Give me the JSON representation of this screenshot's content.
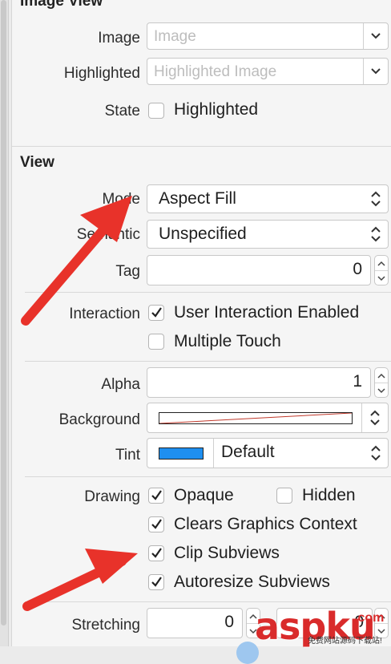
{
  "image_view": {
    "section_title": "Image View",
    "image_label": "Image",
    "image_placeholder": "Image",
    "highlighted_label": "Highlighted",
    "highlighted_placeholder": "Highlighted Image",
    "state_label": "State",
    "state_checkbox_label": "Highlighted",
    "state_checked": false
  },
  "view": {
    "section_title": "View",
    "mode_label": "Mode",
    "mode_value": "Aspect Fill",
    "semantic_label": "Semantic",
    "semantic_value": "Unspecified",
    "tag_label": "Tag",
    "tag_value": "0",
    "interaction_label": "Interaction",
    "user_interaction_label": "User Interaction Enabled",
    "user_interaction_checked": true,
    "multiple_touch_label": "Multiple Touch",
    "multiple_touch_checked": false,
    "alpha_label": "Alpha",
    "alpha_value": "1",
    "background_label": "Background",
    "tint_label": "Tint",
    "tint_value": "Default",
    "tint_color": "#1e8ff0",
    "drawing_label": "Drawing",
    "opaque_label": "Opaque",
    "opaque_checked": true,
    "hidden_label": "Hidden",
    "hidden_checked": false,
    "clears_graphics_label": "Clears Graphics Context",
    "clears_graphics_checked": true,
    "clip_subviews_label": "Clip Subviews",
    "clip_subviews_checked": true,
    "autoresize_label": "Autoresize Subviews",
    "autoresize_checked": true,
    "stretching_label": "Stretching",
    "stretching_x": "0",
    "stretching_y": "0"
  },
  "watermark": {
    "text": "aspku",
    "suffix": ".com",
    "subtitle": "免费网站源码下载站!"
  },
  "colors": {
    "annotation_arrow": "#e8322a",
    "checkmark": "#222222"
  },
  "icons": [
    "chevron-down-icon",
    "chevron-up-down-icon",
    "checkmark-icon",
    "stepper-icon",
    "annotation-arrow"
  ]
}
